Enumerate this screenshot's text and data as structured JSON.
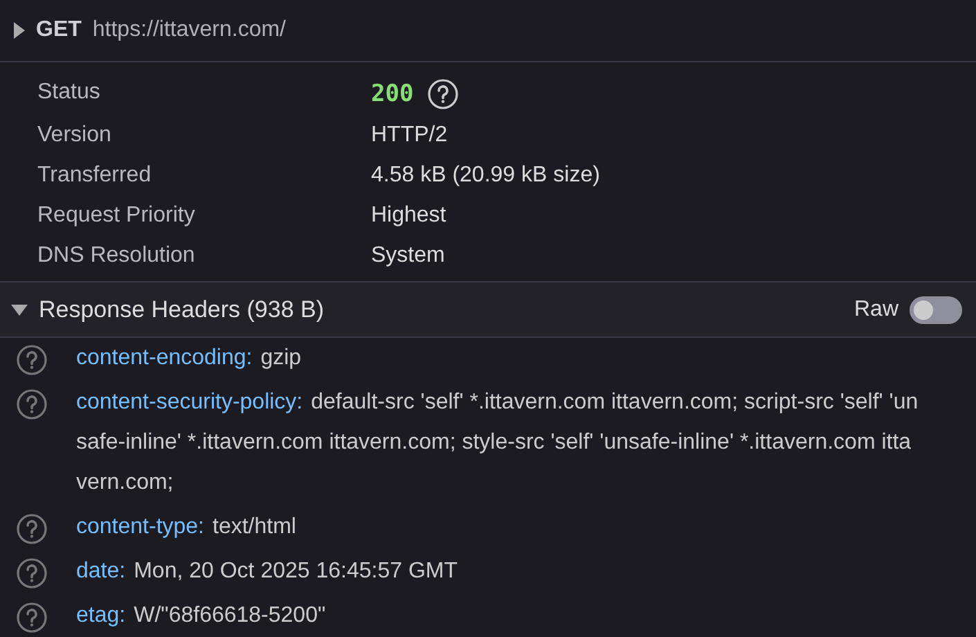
{
  "request": {
    "expanded": false,
    "method": "GET",
    "url": "https://ittavern.com/"
  },
  "summary": [
    {
      "label": "Status",
      "value": "200",
      "kind": "status"
    },
    {
      "label": "Version",
      "value": "HTTP/2",
      "kind": "text"
    },
    {
      "label": "Transferred",
      "value": "4.58 kB (20.99 kB size)",
      "kind": "text"
    },
    {
      "label": "Request Priority",
      "value": "Highest",
      "kind": "text"
    },
    {
      "label": "DNS Resolution",
      "value": "System",
      "kind": "text"
    }
  ],
  "response_headers": {
    "title": "Response Headers (938 B)",
    "expanded": true,
    "raw": {
      "label": "Raw",
      "on": false
    },
    "headers": [
      {
        "name": "content-encoding:",
        "value": "gzip"
      },
      {
        "name": "content-security-policy:",
        "value": "default-src 'self' *.ittavern.com ittavern.com; script-src 'self' 'unsafe-inline' *.ittavern.com ittavern.com; style-src 'self' 'unsafe-inline' *.ittavern.com ittavern.com;"
      },
      {
        "name": "content-type:",
        "value": "text/html"
      },
      {
        "name": "date:",
        "value": "Mon, 20 Oct 2025 16:45:57 GMT"
      },
      {
        "name": "etag:",
        "value": "W/\"68f66618-5200\""
      }
    ]
  }
}
